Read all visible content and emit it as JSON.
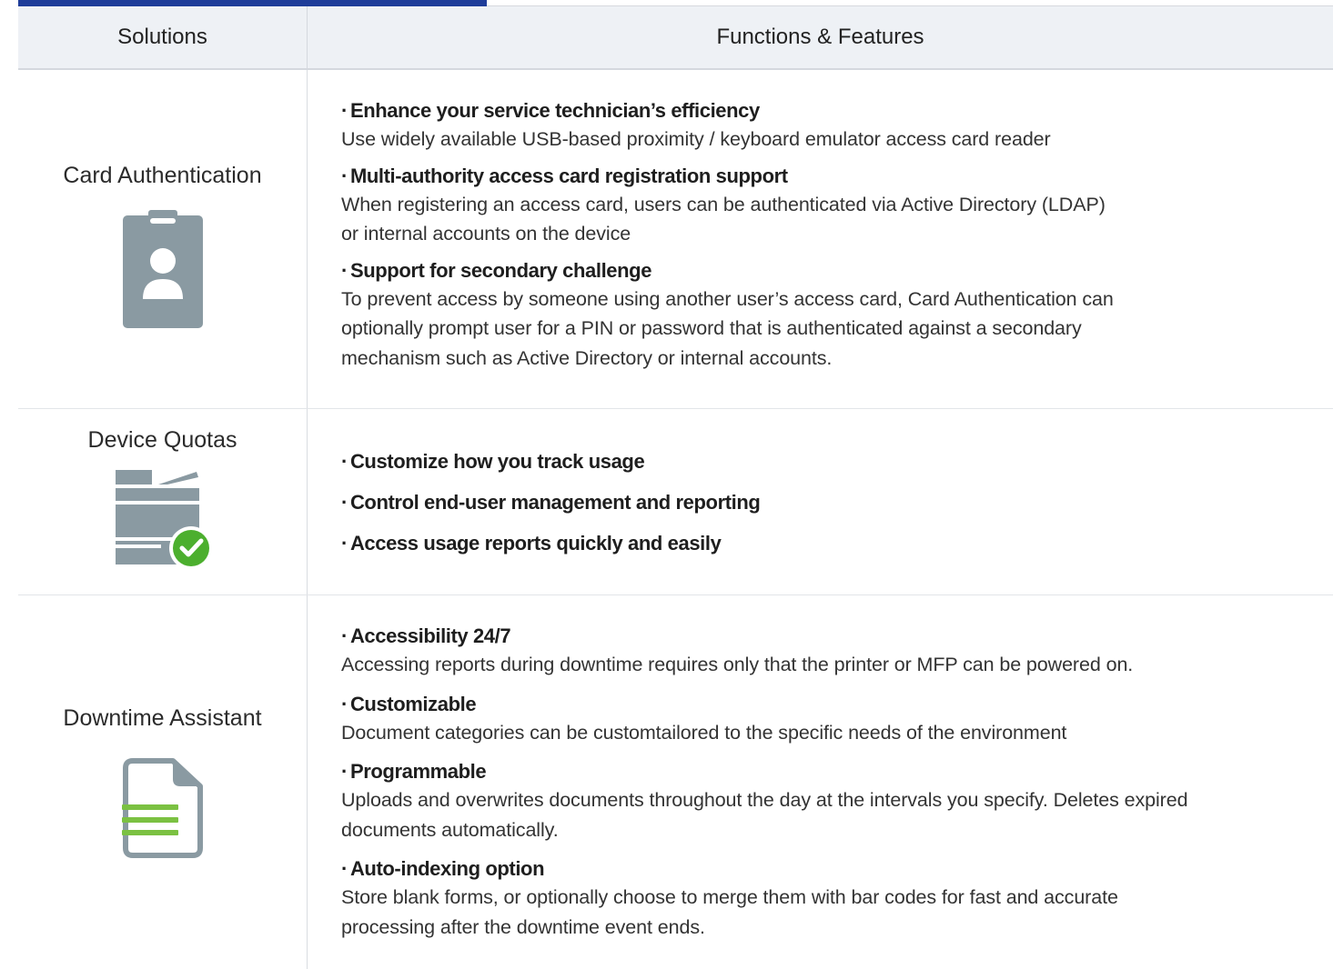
{
  "header": {
    "solutions_label": "Solutions",
    "features_label": "Functions & Features"
  },
  "rows": [
    {
      "solution": "Card Authentication",
      "icon": "id-badge-icon",
      "features": [
        {
          "title": "Enhance your service technician’s efficiency",
          "desc": [
            "Use widely available USB-based proximity / keyboard emulator access card reader"
          ]
        },
        {
          "title": "Multi-authority access card registration support",
          "desc": [
            "When registering an access card, users can be authenticated via Active Directory (LDAP)",
            "or internal accounts on the device"
          ]
        },
        {
          "title": "Support for secondary challenge",
          "desc": [
            "To prevent access by someone using another user’s access card, Card Authentication can",
            "optionally prompt user for a PIN or password that is authenticated against a secondary",
            "mechanism such as Active Directory or internal accounts."
          ]
        }
      ]
    },
    {
      "solution": "Device Quotas",
      "icon": "printer-check-icon",
      "features": [
        {
          "title": "Customize how you track usage"
        },
        {
          "title": "Control end-user management and reporting"
        },
        {
          "title": "Access usage reports quickly and easily"
        }
      ]
    },
    {
      "solution": "Downtime Assistant",
      "icon": "document-icon",
      "features": [
        {
          "title": "Accessibility 24/7",
          "desc": [
            "Accessing reports during downtime requires only that the printer or MFP can be powered on."
          ]
        },
        {
          "title": "Customizable",
          "desc": [
            "Document categories can be customtailored to the specific needs of the environment"
          ]
        },
        {
          "title": "Programmable",
          "desc": [
            "Uploads and overwrites documents throughout the day at the intervals you specify. Deletes expired",
            "documents automatically."
          ]
        },
        {
          "title": "Auto-indexing option",
          "desc": [
            "Store blank forms, or optionally choose to merge them with bar codes for fast and accurate",
            "processing after the downtime event ends."
          ]
        }
      ]
    }
  ],
  "colors": {
    "accent": "#1f3d99",
    "icon_gray": "#8a9aa2",
    "check_green": "#4caf2e",
    "doc_green": "#7bc142"
  },
  "bullet": "·"
}
